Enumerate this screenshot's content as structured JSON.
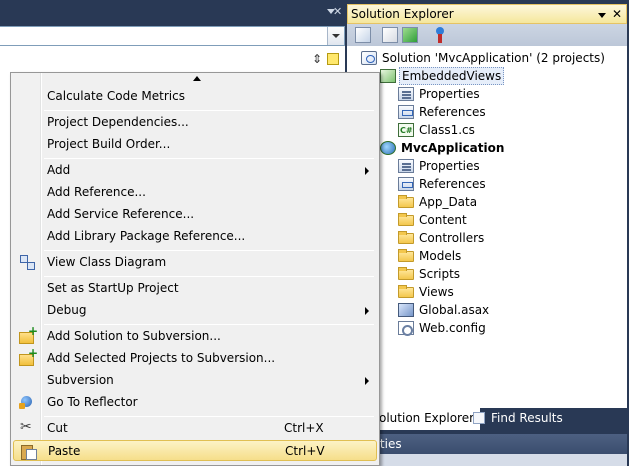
{
  "solution_explorer": {
    "title": "Solution Explorer",
    "tree": [
      {
        "label": "Solution 'MvcApplication' (2 projects)",
        "icon": "solution-icon"
      },
      {
        "label": "EmbeddedViews",
        "icon": "csharp-project-icon",
        "selected": true
      },
      {
        "label": "Properties",
        "icon": "properties-icon"
      },
      {
        "label": "References",
        "icon": "references-icon"
      },
      {
        "label": "Class1.cs",
        "icon": "csharp-file-icon"
      },
      {
        "label": "MvcApplication",
        "icon": "web-project-icon",
        "bold": true
      },
      {
        "label": "Properties",
        "icon": "properties-icon"
      },
      {
        "label": "References",
        "icon": "references-icon"
      },
      {
        "label": "App_Data",
        "icon": "folder-icon"
      },
      {
        "label": "Content",
        "icon": "folder-icon"
      },
      {
        "label": "Controllers",
        "icon": "folder-icon"
      },
      {
        "label": "Models",
        "icon": "folder-icon"
      },
      {
        "label": "Scripts",
        "icon": "folder-icon"
      },
      {
        "label": "Views",
        "icon": "folder-icon"
      },
      {
        "label": "Global.asax",
        "icon": "asax-file-icon"
      },
      {
        "label": "Web.config",
        "icon": "config-file-icon"
      }
    ],
    "tabs": [
      {
        "label": "olution Explorer",
        "active": true
      },
      {
        "label": "Find Results",
        "active": false
      }
    ],
    "properties_header": "rties"
  },
  "context_menu": {
    "items": [
      {
        "label": "Calculate Code Metrics"
      },
      {
        "separator": true
      },
      {
        "label": "Project Dependencies..."
      },
      {
        "label": "Project Build Order..."
      },
      {
        "separator": true
      },
      {
        "label": "Add",
        "submenu": true
      },
      {
        "label": "Add Reference..."
      },
      {
        "label": "Add Service Reference..."
      },
      {
        "label": "Add Library Package Reference..."
      },
      {
        "separator": true
      },
      {
        "label": "View Class Diagram",
        "icon": "class-diagram-icon"
      },
      {
        "separator": true
      },
      {
        "label": "Set as StartUp Project"
      },
      {
        "label": "Debug",
        "submenu": true
      },
      {
        "separator": true
      },
      {
        "label": "Add Solution to Subversion...",
        "icon": "add-subversion-icon"
      },
      {
        "label": "Add Selected Projects to Subversion...",
        "icon": "add-subversion-icon"
      },
      {
        "label": "Subversion",
        "submenu": true
      },
      {
        "label": "Go To Reflector",
        "icon": "reflector-icon"
      },
      {
        "separator": true
      },
      {
        "label": "Cut",
        "shortcut": "Ctrl+X",
        "icon": "cut-icon"
      },
      {
        "label": "Paste",
        "shortcut": "Ctrl+V",
        "icon": "paste-icon",
        "highlighted": true
      }
    ]
  },
  "colors": {
    "ide_background": "#293955",
    "menu_highlight": "#f6de8a",
    "title_bar_active": "#f5e79c"
  }
}
